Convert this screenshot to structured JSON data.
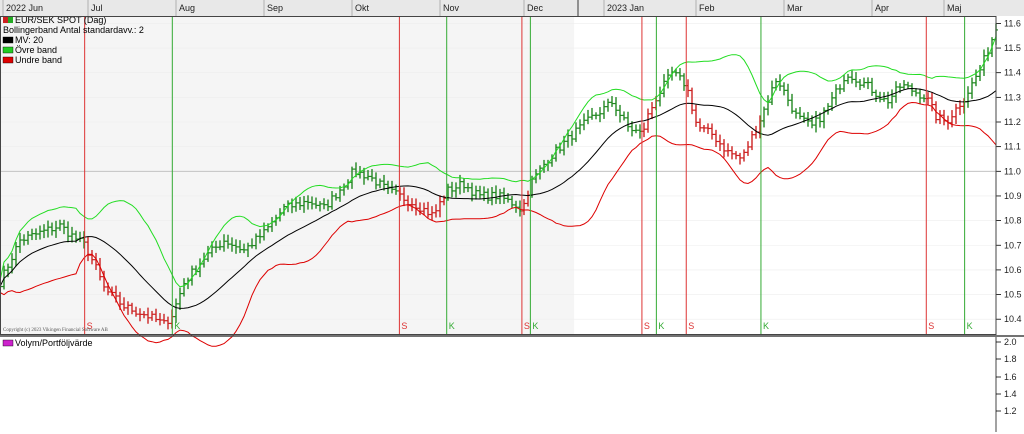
{
  "chart_data": [
    {
      "type": "bar",
      "subtype": "ohlc",
      "title": "EUR/SEK SPOT (Dag)",
      "months": [
        "2022 Jun",
        "Jul",
        "Aug",
        "Sep",
        "Okt",
        "Nov",
        "Dec",
        "2023 Jan",
        "Feb",
        "Mar",
        "Apr",
        "Maj"
      ],
      "yticks": [
        "10.4",
        "10.5",
        "10.6",
        "10.7",
        "10.8",
        "10.9",
        "11.0",
        "11.1",
        "11.2",
        "11.3",
        "11.4",
        "11.5",
        "11.6"
      ],
      "ylim": [
        10.34,
        11.63
      ],
      "reference_line": 11.0,
      "indicator": "Bollingerband  Antal standardavv.: 2",
      "legend": [
        {
          "label": "EUR/SEK SPOT (Dag)",
          "color": "#cc2222",
          "color2": "#22aa22"
        },
        {
          "label": "Bollingerband  Antal standardavv.: 2",
          "color": ""
        },
        {
          "label": "MV: 20",
          "color": "#000000"
        },
        {
          "label": "Övre band",
          "color": "#22cc22"
        },
        {
          "label": "Undre band",
          "color": "#dd0000"
        }
      ],
      "colors": {
        "up": "#228822",
        "down": "#cc2222",
        "mv": "#000000",
        "upper": "#22dd22",
        "lower": "#dd0000",
        "sell_line": "#dd3333",
        "buy_line": "#33aa33"
      },
      "signals": [
        {
          "t": 0.17,
          "type": "sell",
          "label": "S"
        },
        {
          "t": 0.346,
          "type": "buy",
          "label": "K"
        },
        {
          "t": 0.802,
          "type": "sell",
          "label": "S"
        },
        {
          "t": 0.897,
          "type": "buy",
          "label": "K"
        },
        {
          "t": 1.048,
          "type": "sell",
          "label": "S"
        },
        {
          "t": 1.065,
          "type": "buy",
          "label": "K"
        },
        {
          "t": 1.289,
          "type": "sell",
          "label": "S"
        },
        {
          "t": 1.318,
          "type": "buy",
          "label": "K"
        },
        {
          "t": 1.378,
          "type": "sell",
          "label": "S"
        },
        {
          "t": 1.528,
          "type": "buy",
          "label": "K"
        },
        {
          "t": 1.86,
          "type": "sell",
          "label": "S"
        },
        {
          "t": 1.937,
          "type": "buy",
          "label": "K"
        }
      ],
      "close_anchors": [
        [
          0.0,
          10.55
        ],
        [
          0.04,
          10.72
        ],
        [
          0.08,
          10.75
        ],
        [
          0.12,
          10.78
        ],
        [
          0.15,
          10.73
        ],
        [
          0.17,
          10.7
        ],
        [
          0.19,
          10.62
        ],
        [
          0.21,
          10.52
        ],
        [
          0.25,
          10.45
        ],
        [
          0.29,
          10.42
        ],
        [
          0.33,
          10.38
        ],
        [
          0.346,
          10.42
        ],
        [
          0.37,
          10.55
        ],
        [
          0.41,
          10.65
        ],
        [
          0.45,
          10.72
        ],
        [
          0.49,
          10.68
        ],
        [
          0.53,
          10.75
        ],
        [
          0.57,
          10.85
        ],
        [
          0.62,
          10.88
        ],
        [
          0.65,
          10.85
        ],
        [
          0.68,
          10.92
        ],
        [
          0.71,
          11.0
        ],
        [
          0.74,
          10.98
        ],
        [
          0.78,
          10.92
        ],
        [
          0.802,
          10.9
        ],
        [
          0.84,
          10.86
        ],
        [
          0.87,
          10.82
        ],
        [
          0.897,
          10.92
        ],
        [
          0.93,
          10.95
        ],
        [
          0.96,
          10.9
        ],
        [
          1.0,
          10.9
        ],
        [
          1.04,
          10.86
        ],
        [
          1.048,
          10.84
        ],
        [
          1.065,
          10.95
        ],
        [
          1.1,
          11.05
        ],
        [
          1.15,
          11.15
        ],
        [
          1.19,
          11.22
        ],
        [
          1.23,
          11.28
        ],
        [
          1.26,
          11.18
        ],
        [
          1.289,
          11.15
        ],
        [
          1.3,
          11.22
        ],
        [
          1.318,
          11.3
        ],
        [
          1.35,
          11.4
        ],
        [
          1.378,
          11.35
        ],
        [
          1.4,
          11.18
        ],
        [
          1.43,
          11.15
        ],
        [
          1.46,
          11.08
        ],
        [
          1.49,
          11.05
        ],
        [
          1.528,
          11.22
        ],
        [
          1.56,
          11.38
        ],
        [
          1.6,
          11.22
        ],
        [
          1.63,
          11.18
        ],
        [
          1.66,
          11.25
        ],
        [
          1.7,
          11.4
        ],
        [
          1.74,
          11.35
        ],
        [
          1.78,
          11.28
        ],
        [
          1.81,
          11.35
        ],
        [
          1.84,
          11.32
        ],
        [
          1.86,
          11.3
        ],
        [
          1.88,
          11.22
        ],
        [
          1.9,
          11.2
        ],
        [
          1.937,
          11.3
        ],
        [
          1.97,
          11.42
        ],
        [
          2.0,
          11.58
        ]
      ],
      "sub_panel": {
        "legend": "Volym/Portföljvärde",
        "legend_color": "#cc22cc",
        "yticks": [
          "1.2",
          "1.4",
          "1.6",
          "1.8",
          "2.0"
        ]
      },
      "copyright": "Copyright (c) 2023 Vikingen Financial Software AB",
      "shaded_period": "2022 Jun – Dec"
    }
  ]
}
